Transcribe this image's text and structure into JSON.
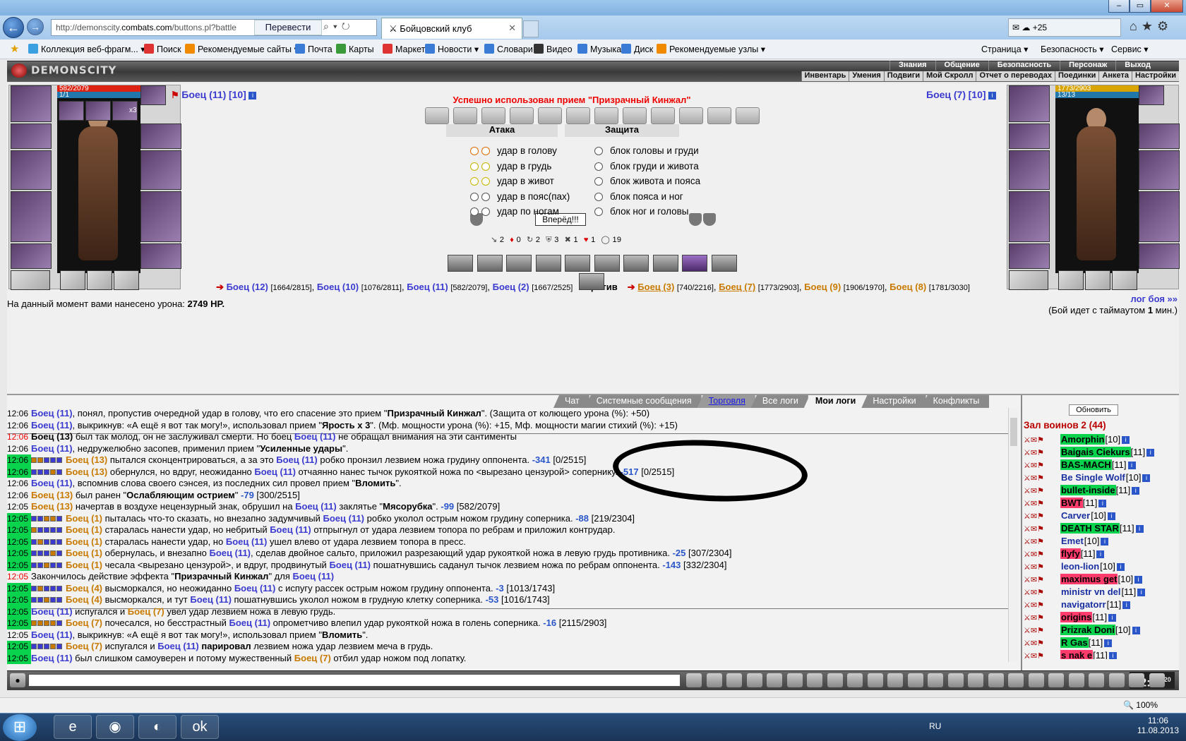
{
  "browser": {
    "url_prefix": "http://demonscity.",
    "url_host": "combats.com",
    "url_path": "/buttons.pl?battle",
    "translate_label": "Перевести",
    "tab_title": "Бойцовский клуб",
    "weather": "+25",
    "favorites": [
      {
        "label": "Коллекция веб-фрагм... ▾",
        "color": "#3aa0e0"
      },
      {
        "label": "Поиск",
        "color": "#d33"
      },
      {
        "label": "Рекомендуемые сайты ▾",
        "color": "#f08a00"
      },
      {
        "label": "Почта",
        "color": "#3a7bd5"
      },
      {
        "label": "Карты",
        "color": "#3a9a3a"
      },
      {
        "label": "Маркет",
        "color": "#d33"
      },
      {
        "label": "Новости ▾",
        "color": "#3a7bd5"
      },
      {
        "label": "Словари",
        "color": "#3a7bd5"
      },
      {
        "label": "Видео",
        "color": "#333"
      },
      {
        "label": "Музыка",
        "color": "#3a7bd5"
      },
      {
        "label": "Диск",
        "color": "#3a7bd5"
      },
      {
        "label": "Рекомендуемые узлы ▾",
        "color": "#f08a00"
      }
    ],
    "commands": [
      "Страница ▾",
      "Безопасность ▾",
      "Сервис ▾"
    ],
    "zoom": "100%"
  },
  "game": {
    "logo": "DEMONSCITY",
    "menu_top": [
      "Знания",
      "Общение",
      "Безопасность",
      "Персонаж",
      "Выход"
    ],
    "menu_sub": [
      "Инвентарь",
      "Умения",
      "Подвиги",
      "Мой Скролл",
      "Отчет о переводах",
      "Поединки",
      "Анкета",
      "Настройки"
    ],
    "left_player": {
      "name": "Боец (11)",
      "level": "[10]",
      "hp": "582/2079",
      "mana": "1/1",
      "x3": "x3"
    },
    "right_player": {
      "name": "Боец (7)",
      "level": "[10]",
      "hp": "1773/2903",
      "mana": "13/13"
    },
    "success_msg": "Успешно использован прием \"Призрачный Кинжал\"",
    "attack_header": "Атака",
    "defense_header": "Защита",
    "attacks": [
      "удар в голову",
      "удар в грудь",
      "удар в живот",
      "удар в пояс(пах)",
      "удар по ногам"
    ],
    "defenses": [
      "блок головы и груди",
      "блок груди и живота",
      "блок живота и пояса",
      "блок пояса и ног",
      "блок ног и головы"
    ],
    "go_button": "Вперёд!!!",
    "stats": [
      "2",
      "0",
      "2",
      "3",
      "1",
      "1",
      "19"
    ],
    "team_blue": [
      {
        "name": "Боец (12)",
        "hp": "[1664/2815]"
      },
      {
        "name": "Боец (10)",
        "hp": "[1076/2811]"
      },
      {
        "name": "Боец (11)",
        "hp": "[582/2079]"
      },
      {
        "name": "Боец (2)",
        "hp": "[1667/2525]"
      }
    ],
    "vs_label": "против",
    "team_orange": [
      {
        "name": "Боец (3)",
        "hp": "[740/2216]"
      },
      {
        "name": "Боец (7)",
        "hp": "[1773/2903]"
      },
      {
        "name": "Боец (9)",
        "hp": "[1906/1970]"
      },
      {
        "name": "Боец (8)",
        "hp": "[1781/3030]"
      }
    ],
    "damage_label": "На данный момент вами нанесено урона:",
    "damage_value": "2749 HP.",
    "log_link": "лог боя »»",
    "timeout_pre": "(Бой идет с таймаутом",
    "timeout_val": "1",
    "timeout_post": "мин.)"
  },
  "chat": {
    "tabs": [
      "Чат",
      "Системные сообщения",
      "Торговля",
      "Все логи",
      "Мои логи",
      "Настройки",
      "Конфликты"
    ],
    "lines": [
      {
        "t": "12:06",
        "c": "n",
        "html": "<span class='tb'>Боец (11)</span>, понял, пропустив очередной удар в голову, что его спасение это прием \"<b>Призрачный Кинжал</b>\". (Защита от колющего урона (%): +50)"
      },
      {
        "t": "12:06",
        "c": "n",
        "html": "<span class='tb'>Боец (11)</span>, выкрикнув: «А ещё я вот так могу!», использовал прием \"<b>Ярость х 3</b>\". (Мф. мощности урона (%): +15, Мф. мощности магии стихий (%): +15)",
        "sep": true
      },
      {
        "t": "12:06",
        "c": "r",
        "html": "<b>Боец (13)</b> был так молод, он не заслуживал смерти. Но боец <span class='tb'>Боец (11)</span> не обращал внимания на эти сантименты"
      },
      {
        "t": "12:06",
        "c": "n",
        "html": "<span class='tb'>Боец (11)</span>, недружелюбно засопев, применил прием \"<b>Усиленные удары</b>\"."
      },
      {
        "t": "12:06",
        "c": "g",
        "boxes": "ffbbb",
        "html": "<span class='tr'>Боец (13)</span> пытался сконцентрироваться, а за это <span class='tb'>Боец (11)</span> робко пронзил лезвием ножа грудину оппонента. <span class='num'>-341</span> [0/2515]"
      },
      {
        "t": "12:06",
        "c": "g",
        "boxes": "bbbfb",
        "html": "<span class='tr'>Боец (13)</span> обернулся, но вдруг, неожиданно <span class='tb'>Боец (11)</span> отчаянно нанес тычок рукояткой ножа по &lt;вырезано цензурой&gt; сопернику. <span class='num'>-517</span> [0/2515]"
      },
      {
        "t": "12:06",
        "c": "n",
        "html": "<span class='tb'>Боец (11)</span>, вспомнив слова своего сэнсея, из последних сил провел прием \"<b>Вломить</b>\"."
      },
      {
        "t": "12:06",
        "c": "n",
        "html": "<span class='tr'>Боец (13)</span> был ранен \"<b>Ослабляющим острием</b>\" <span class='num'>-79</span> [300/2515]"
      },
      {
        "t": "12:05",
        "c": "n",
        "html": "<span class='tr'>Боец (13)</span> начертав в воздухе нецензурный знак, обрушил на <span class='tb'>Боец (11)</span> заклятье \"<b>Мясорубка</b>\". <span class='num'>-99</span> [582/2079]"
      },
      {
        "t": "12:05",
        "c": "g",
        "boxes": "bbffb",
        "html": "<span class='tr'>Боец (1)</span> пыталась что-то сказать, но внезапно задумчивый <span class='tb'>Боец (11)</span> робко уколол острым ножом грудину соперника. <span class='num'>-88</span> [219/2304]"
      },
      {
        "t": "12:05",
        "c": "g",
        "boxes": "fbbbb",
        "html": "<span class='tr'>Боец (1)</span> старалась нанести удар, но небритый <span class='tb'>Боец (11)</span> отпрыгнул от удара лезвием топора по ребрам и приложил контрудар."
      },
      {
        "t": "12:05",
        "c": "g",
        "boxes": "bfbbb",
        "html": "<span class='tr'>Боец (1)</span> старалась нанести удар, но <span class='tb'>Боец (11)</span> ушел влево от удара лезвием топора в пресс."
      },
      {
        "t": "12:05",
        "c": "g",
        "boxes": "bbbfb",
        "html": "<span class='tr'>Боец (1)</span> обернулась, и внезапно <span class='tb'>Боец (11)</span>, сделав двойное сальто, приложил разрезающий удар рукояткой ножа в левую грудь противника. <span class='num'>-25</span> [307/2304]"
      },
      {
        "t": "12:05",
        "c": "g",
        "boxes": "bbfbb",
        "html": "<span class='tr'>Боец (1)</span> чесала &lt;вырезано цензурой&gt;, и вдруг, продвинутый <span class='tb'>Боец (11)</span> пошатнувшись саданул тычок лезвием ножа по ребрам оппонента. <span class='num'>-143</span> [332/2304]"
      },
      {
        "t": "12:05",
        "c": "r",
        "html": "Закончилось действие эффекта \"<b>Призрачный Кинжал</b>\" для <span class='tb'>Боец (11)</span>"
      },
      {
        "t": "12:05",
        "c": "g",
        "boxes": "bfbbb",
        "html": "<span class='tr'>Боец (4)</span> высморкался, но неожиданно <span class='tb'>Боец (11)</span> с испугу рассек острым ножом грудину оппонента. <span class='num'>-3</span> [1013/1743]"
      },
      {
        "t": "12:05",
        "c": "g",
        "boxes": "bbfbb",
        "html": "<span class='tr'>Боец (4)</span> высморкался, и тут <span class='tb'>Боец (11)</span> пошатнувшись уколол ножом в грудную клетку соперника. <span class='num'>-53</span> [1016/1743]",
        "sep": true
      },
      {
        "t": "12:05",
        "c": "g",
        "html": "<span class='tb'>Боец (11)</span> испугался и <span class='tr'>Боец (7)</span> увел удар лезвием ножа в левую грудь."
      },
      {
        "t": "12:05",
        "c": "g",
        "boxes": "ffffb",
        "html": "<span class='tr'>Боец (7)</span> почесался, но бесстрастный <span class='tb'>Боец (11)</span> опрометчиво влепил удар рукояткой ножа в голень соперника. <span class='num'>-16</span> [2115/2903]"
      },
      {
        "t": "12:05",
        "c": "n",
        "html": "<span class='tb'>Боец (11)</span>, выкрикнув: «А ещё я вот так могу!», использовал прием \"<b>Вломить</b>\"."
      },
      {
        "t": "12:05",
        "c": "g",
        "boxes": "bbbfb",
        "html": "<span class='tr'>Боец (7)</span> испугался и <span class='tb'>Боец (11)</span> <b>парировал</b> лезвием ножа удар лезвием меча в грудь."
      },
      {
        "t": "12:05",
        "c": "g",
        "html": "<span class='tb'>Боец (11)</span> был слишком самоуверен и потому мужественный <span class='tr'>Боец (7)</span> отбил удар ножом под лопатку."
      }
    ]
  },
  "room": {
    "refresh": "Обновить",
    "title": "Зал воинов 2 (44)",
    "players": [
      {
        "name": "Amorphin",
        "lv": "[10]",
        "s": "gr"
      },
      {
        "name": "Baigais Ciekurs",
        "lv": "[11]",
        "s": "gr"
      },
      {
        "name": "BAS-MACH",
        "lv": "[11]",
        "s": "gr"
      },
      {
        "name": "Be Single Wolf",
        "lv": "[10]",
        "s": "nb"
      },
      {
        "name": "bullet-inside",
        "lv": "[11]",
        "s": "gr"
      },
      {
        "name": "BWT",
        "lv": "[11]",
        "s": "pk"
      },
      {
        "name": "Carver",
        "lv": "[10]",
        "s": "nb"
      },
      {
        "name": "DEATH STAR",
        "lv": "[11]",
        "s": "gr"
      },
      {
        "name": "Emet",
        "lv": "[10]",
        "s": "nb"
      },
      {
        "name": "flyfy",
        "lv": "[11]",
        "s": "pk"
      },
      {
        "name": "leon-lion",
        "lv": "[10]",
        "s": "nb"
      },
      {
        "name": "maximus get",
        "lv": "[10]",
        "s": "pk"
      },
      {
        "name": "ministr vn del",
        "lv": "[11]",
        "s": "nb"
      },
      {
        "name": "navigatorr",
        "lv": "[11]",
        "s": "nb"
      },
      {
        "name": "origins",
        "lv": "[11]",
        "s": "pk"
      },
      {
        "name": "Prizrak Doni",
        "lv": "[10]",
        "s": "gr"
      },
      {
        "name": "R Gas",
        "lv": "[11]",
        "s": "gr"
      },
      {
        "name": "s nak e",
        "lv": "[11]",
        "s": "pk"
      }
    ]
  },
  "clock": "12:06",
  "clock_seconds": "20",
  "taskbar": {
    "lang": "RU",
    "time": "11:06",
    "date": "11.08.2013"
  }
}
